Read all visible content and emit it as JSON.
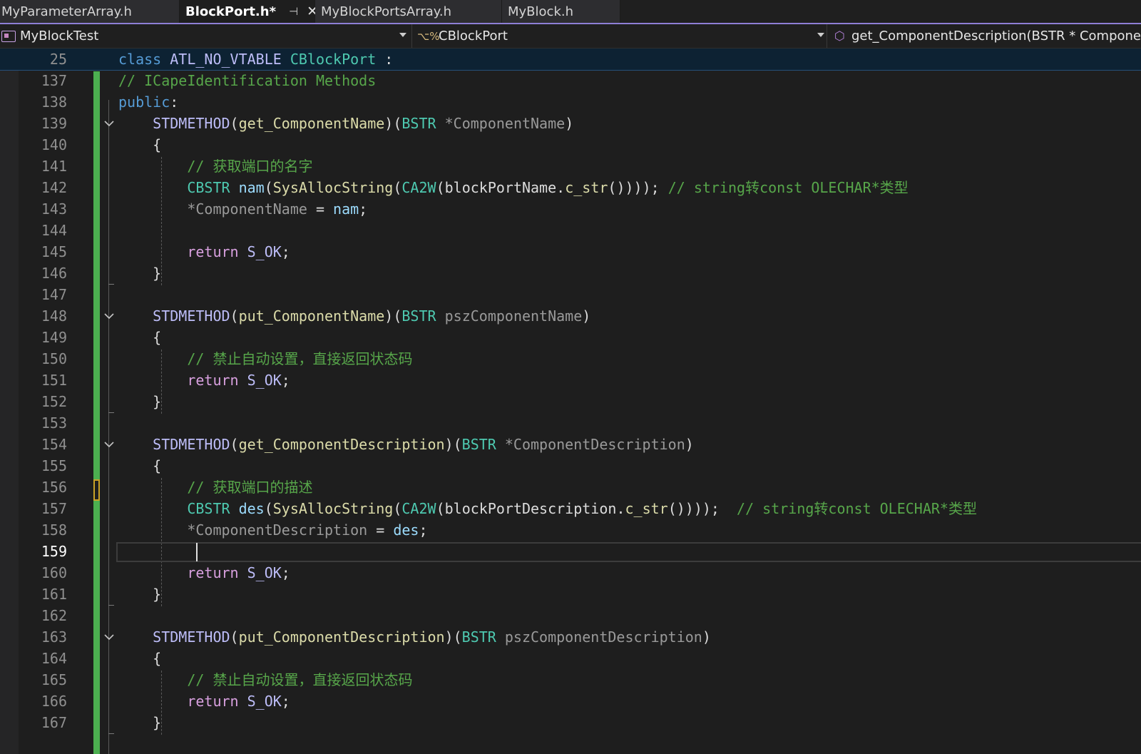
{
  "tabs": [
    {
      "label": "MyParameterArray.h",
      "active": false
    },
    {
      "label": "BlockPort.h*",
      "active": true,
      "pin_icon": "pin-icon",
      "close_icon": "close-icon"
    },
    {
      "label": "MyBlockPortsArray.h",
      "active": false
    },
    {
      "label": "MyBlock.h",
      "active": false
    }
  ],
  "navbar": {
    "project": "MyBlockTest",
    "class": "CBlockPort",
    "member": "get_ComponentDescription(BSTR * Compone",
    "icons": [
      "project-icon",
      "class-icon",
      "method-icon"
    ]
  },
  "sticky_header": {
    "line_number": "25",
    "tokens": [
      {
        "t": "class ",
        "c": "kw"
      },
      {
        "t": "ATL_NO_VTABLE ",
        "c": "mac"
      },
      {
        "t": "CBlockPort",
        "c": "cls"
      },
      {
        "t": " :",
        "c": "plain"
      }
    ]
  },
  "editor": {
    "current_line": "159",
    "change_bar_color": "#4caf50",
    "lines": [
      {
        "n": "137",
        "tokens": [
          {
            "t": "// ICapeIdentification Methods",
            "c": "cm"
          }
        ]
      },
      {
        "n": "138",
        "tokens": [
          {
            "t": "public",
            "c": "kw"
          },
          {
            "t": ":",
            "c": "plain"
          }
        ]
      },
      {
        "n": "139",
        "tokens": [
          {
            "t": "    ",
            "c": "plain"
          },
          {
            "t": "STDMETHOD",
            "c": "mac"
          },
          {
            "t": "(",
            "c": "plain"
          },
          {
            "t": "get_ComponentName",
            "c": "fn"
          },
          {
            "t": ")(",
            "c": "plain"
          },
          {
            "t": "BSTR",
            "c": "ty"
          },
          {
            "t": " ",
            "c": "plain"
          },
          {
            "t": "*ComponentName",
            "c": "pr"
          },
          {
            "t": ")",
            "c": "plain"
          }
        ]
      },
      {
        "n": "140",
        "tokens": [
          {
            "t": "    {",
            "c": "plain"
          }
        ]
      },
      {
        "n": "141",
        "tokens": [
          {
            "t": "        ",
            "c": "plain"
          },
          {
            "t": "// 获取端口的名字",
            "c": "cm"
          }
        ]
      },
      {
        "n": "142",
        "tokens": [
          {
            "t": "        ",
            "c": "plain"
          },
          {
            "t": "CBSTR",
            "c": "ty"
          },
          {
            "t": " ",
            "c": "plain"
          },
          {
            "t": "nam",
            "c": "var"
          },
          {
            "t": "(",
            "c": "plain"
          },
          {
            "t": "SysAllocString",
            "c": "fn"
          },
          {
            "t": "(",
            "c": "plain"
          },
          {
            "t": "CA2W",
            "c": "ty"
          },
          {
            "t": "(",
            "c": "plain"
          },
          {
            "t": "blockPortName",
            "c": "plain"
          },
          {
            "t": ".",
            "c": "plain"
          },
          {
            "t": "c_str",
            "c": "fn"
          },
          {
            "t": "()))); ",
            "c": "plain"
          },
          {
            "t": "// string转const OLECHAR*类型",
            "c": "cm"
          }
        ]
      },
      {
        "n": "143",
        "tokens": [
          {
            "t": "        ",
            "c": "plain"
          },
          {
            "t": "*ComponentName",
            "c": "pr"
          },
          {
            "t": " = ",
            "c": "plain"
          },
          {
            "t": "nam",
            "c": "var"
          },
          {
            "t": ";",
            "c": "plain"
          }
        ]
      },
      {
        "n": "144",
        "tokens": []
      },
      {
        "n": "145",
        "tokens": [
          {
            "t": "        ",
            "c": "plain"
          },
          {
            "t": "return",
            "c": "kw2"
          },
          {
            "t": " ",
            "c": "plain"
          },
          {
            "t": "S_OK",
            "c": "mac"
          },
          {
            "t": ";",
            "c": "plain"
          }
        ]
      },
      {
        "n": "146",
        "tokens": [
          {
            "t": "    }",
            "c": "plain"
          }
        ]
      },
      {
        "n": "147",
        "tokens": []
      },
      {
        "n": "148",
        "tokens": [
          {
            "t": "    ",
            "c": "plain"
          },
          {
            "t": "STDMETHOD",
            "c": "mac"
          },
          {
            "t": "(",
            "c": "plain"
          },
          {
            "t": "put_ComponentName",
            "c": "fn"
          },
          {
            "t": ")(",
            "c": "plain"
          },
          {
            "t": "BSTR",
            "c": "ty"
          },
          {
            "t": " ",
            "c": "plain"
          },
          {
            "t": "pszComponentName",
            "c": "pr"
          },
          {
            "t": ")",
            "c": "plain"
          }
        ]
      },
      {
        "n": "149",
        "tokens": [
          {
            "t": "    {",
            "c": "plain"
          }
        ]
      },
      {
        "n": "150",
        "tokens": [
          {
            "t": "        ",
            "c": "plain"
          },
          {
            "t": "// 禁止自动设置，直接返回状态码",
            "c": "cm"
          }
        ]
      },
      {
        "n": "151",
        "tokens": [
          {
            "t": "        ",
            "c": "plain"
          },
          {
            "t": "return",
            "c": "kw2"
          },
          {
            "t": " ",
            "c": "plain"
          },
          {
            "t": "S_OK",
            "c": "mac"
          },
          {
            "t": ";",
            "c": "plain"
          }
        ]
      },
      {
        "n": "152",
        "tokens": [
          {
            "t": "    }",
            "c": "plain"
          }
        ]
      },
      {
        "n": "153",
        "tokens": []
      },
      {
        "n": "154",
        "tokens": [
          {
            "t": "    ",
            "c": "plain"
          },
          {
            "t": "STDMETHOD",
            "c": "mac"
          },
          {
            "t": "(",
            "c": "plain"
          },
          {
            "t": "get_ComponentDescription",
            "c": "fn"
          },
          {
            "t": ")(",
            "c": "plain"
          },
          {
            "t": "BSTR",
            "c": "ty"
          },
          {
            "t": " ",
            "c": "plain"
          },
          {
            "t": "*ComponentDescription",
            "c": "pr"
          },
          {
            "t": ")",
            "c": "plain"
          }
        ]
      },
      {
        "n": "155",
        "tokens": [
          {
            "t": "    {",
            "c": "plain"
          }
        ]
      },
      {
        "n": "156",
        "tokens": [
          {
            "t": "        ",
            "c": "plain"
          },
          {
            "t": "// 获取端口的描述",
            "c": "cm"
          }
        ]
      },
      {
        "n": "157",
        "tokens": [
          {
            "t": "        ",
            "c": "plain"
          },
          {
            "t": "CBSTR",
            "c": "ty"
          },
          {
            "t": " ",
            "c": "plain"
          },
          {
            "t": "des",
            "c": "var"
          },
          {
            "t": "(",
            "c": "plain"
          },
          {
            "t": "SysAllocString",
            "c": "fn"
          },
          {
            "t": "(",
            "c": "plain"
          },
          {
            "t": "CA2W",
            "c": "ty"
          },
          {
            "t": "(",
            "c": "plain"
          },
          {
            "t": "blockPortDescription",
            "c": "plain"
          },
          {
            "t": ".",
            "c": "plain"
          },
          {
            "t": "c_str",
            "c": "fn"
          },
          {
            "t": "())));  ",
            "c": "plain"
          },
          {
            "t": "// string转const OLECHAR*类型",
            "c": "cm"
          }
        ]
      },
      {
        "n": "158",
        "tokens": [
          {
            "t": "        ",
            "c": "plain"
          },
          {
            "t": "*ComponentDescription",
            "c": "pr"
          },
          {
            "t": " = ",
            "c": "plain"
          },
          {
            "t": "des",
            "c": "var"
          },
          {
            "t": ";",
            "c": "plain"
          }
        ]
      },
      {
        "n": "159",
        "tokens": []
      },
      {
        "n": "160",
        "tokens": [
          {
            "t": "        ",
            "c": "plain"
          },
          {
            "t": "return",
            "c": "kw2"
          },
          {
            "t": " ",
            "c": "plain"
          },
          {
            "t": "S_OK",
            "c": "mac"
          },
          {
            "t": ";",
            "c": "plain"
          }
        ]
      },
      {
        "n": "161",
        "tokens": [
          {
            "t": "    }",
            "c": "plain"
          }
        ]
      },
      {
        "n": "162",
        "tokens": []
      },
      {
        "n": "163",
        "tokens": [
          {
            "t": "    ",
            "c": "plain"
          },
          {
            "t": "STDMETHOD",
            "c": "mac"
          },
          {
            "t": "(",
            "c": "plain"
          },
          {
            "t": "put_ComponentDescription",
            "c": "fn"
          },
          {
            "t": ")(",
            "c": "plain"
          },
          {
            "t": "BSTR",
            "c": "ty"
          },
          {
            "t": " ",
            "c": "plain"
          },
          {
            "t": "pszComponentDescription",
            "c": "pr"
          },
          {
            "t": ")",
            "c": "plain"
          }
        ]
      },
      {
        "n": "164",
        "tokens": [
          {
            "t": "    {",
            "c": "plain"
          }
        ]
      },
      {
        "n": "165",
        "tokens": [
          {
            "t": "        ",
            "c": "plain"
          },
          {
            "t": "// 禁止自动设置，直接返回状态码",
            "c": "cm"
          }
        ]
      },
      {
        "n": "166",
        "tokens": [
          {
            "t": "        ",
            "c": "plain"
          },
          {
            "t": "return",
            "c": "kw2"
          },
          {
            "t": " ",
            "c": "plain"
          },
          {
            "t": "S_OK",
            "c": "mac"
          },
          {
            "t": ";",
            "c": "plain"
          }
        ]
      },
      {
        "n": "167",
        "tokens": [
          {
            "t": "    }",
            "c": "plain"
          }
        ]
      }
    ]
  }
}
